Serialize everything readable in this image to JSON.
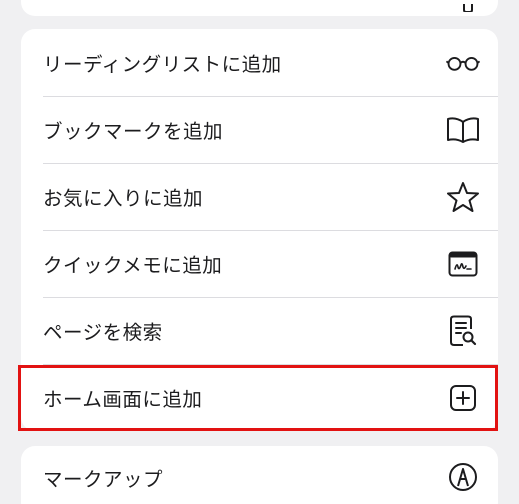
{
  "menu": {
    "items": [
      {
        "label": "リーディングリストに追加",
        "icon": "glasses-icon"
      },
      {
        "label": "ブックマークを追加",
        "icon": "book-icon"
      },
      {
        "label": "お気に入りに追加",
        "icon": "star-icon"
      },
      {
        "label": "クイックメモに追加",
        "icon": "quick-note-icon"
      },
      {
        "label": "ページを検索",
        "icon": "find-in-page-icon"
      },
      {
        "label": "ホーム画面に追加",
        "icon": "plus-square-icon"
      }
    ]
  },
  "lower_menu": {
    "items": [
      {
        "label": "マークアップ",
        "icon": "markup-pen-icon"
      }
    ]
  },
  "highlight": {
    "color": "#e21212",
    "target": "ホーム画面に追加"
  }
}
